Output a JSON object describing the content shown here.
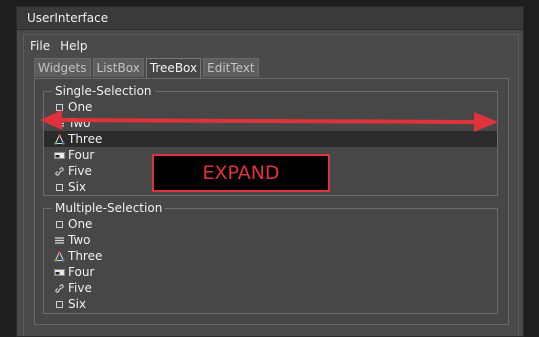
{
  "window": {
    "title": "UserInterface"
  },
  "menu": {
    "file": "File",
    "help": "Help"
  },
  "tabs": [
    {
      "label": "Widgets",
      "active": false
    },
    {
      "label": "ListBox",
      "active": false
    },
    {
      "label": "TreeBox",
      "active": true
    },
    {
      "label": "EditText",
      "active": false
    }
  ],
  "single_selection": {
    "title": "Single-Selection",
    "items": [
      {
        "label": "One",
        "icon": "checkbox-icon"
      },
      {
        "label": "Two",
        "icon": "stack-icon"
      },
      {
        "label": "Three",
        "icon": "molecule-icon",
        "selected": true
      },
      {
        "label": "Four",
        "icon": "drive-icon"
      },
      {
        "label": "Five",
        "icon": "link-icon"
      },
      {
        "label": "Six",
        "icon": "checkbox-icon"
      }
    ]
  },
  "multiple_selection": {
    "title": "Multiple-Selection",
    "items": [
      {
        "label": "One",
        "icon": "checkbox-icon"
      },
      {
        "label": "Two",
        "icon": "stack-icon"
      },
      {
        "label": "Three",
        "icon": "molecule-icon"
      },
      {
        "label": "Four",
        "icon": "drive-icon"
      },
      {
        "label": "Five",
        "icon": "link-icon"
      },
      {
        "label": "Six",
        "icon": "checkbox-icon"
      }
    ]
  },
  "annotation": {
    "label": "EXPAND",
    "color": "#e0323a"
  }
}
